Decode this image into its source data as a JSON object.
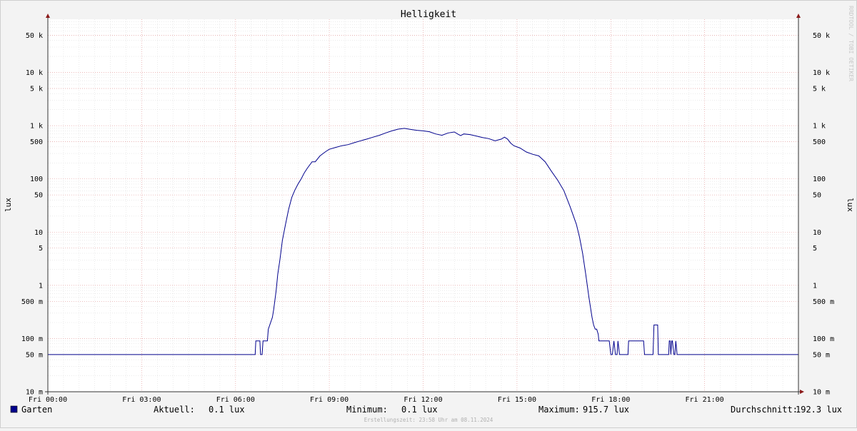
{
  "chart_data": {
    "type": "line",
    "title": "Helligkeit",
    "ylabel": "lux",
    "watermark": "RRDTOOL / TOBI OETIKER",
    "yscale": "log",
    "ylim": [
      0.01,
      100000
    ],
    "grid": true,
    "x_range_hours": [
      0,
      24
    ],
    "x_ticks": [
      {
        "hour": 0,
        "label": "Fri 00:00"
      },
      {
        "hour": 3,
        "label": "Fri 03:00"
      },
      {
        "hour": 6,
        "label": "Fri 06:00"
      },
      {
        "hour": 9,
        "label": "Fri 09:00"
      },
      {
        "hour": 12,
        "label": "Fri 12:00"
      },
      {
        "hour": 15,
        "label": "Fri 15:00"
      },
      {
        "hour": 18,
        "label": "Fri 18:00"
      },
      {
        "hour": 21,
        "label": "Fri 21:00"
      }
    ],
    "y_ticks": [
      {
        "value": 50000,
        "label": "50 k"
      },
      {
        "value": 10000,
        "label": "10 k"
      },
      {
        "value": 5000,
        "label": "5 k"
      },
      {
        "value": 1000,
        "label": "1 k"
      },
      {
        "value": 500,
        "label": "500"
      },
      {
        "value": 100,
        "label": "100"
      },
      {
        "value": 50,
        "label": "50"
      },
      {
        "value": 10,
        "label": "10"
      },
      {
        "value": 5,
        "label": "5"
      },
      {
        "value": 1,
        "label": "1"
      },
      {
        "value": 0.5,
        "label": "500 m"
      },
      {
        "value": 0.1,
        "label": "100 m"
      },
      {
        "value": 0.05,
        "label": "50 m"
      },
      {
        "value": 0.01,
        "label": "10 m"
      }
    ],
    "series": [
      {
        "name": "Garten",
        "color": "#00008c",
        "x_hours": [
          0,
          6.63,
          6.65,
          6.78,
          6.8,
          6.85,
          6.88,
          7.02,
          7.05,
          7.18,
          7.22,
          7.3,
          7.35,
          7.42,
          7.5,
          7.6,
          7.7,
          7.8,
          7.9,
          8.0,
          8.1,
          8.2,
          8.3,
          8.45,
          8.55,
          8.7,
          8.8,
          8.9,
          9.0,
          9.2,
          9.4,
          9.6,
          9.8,
          10.0,
          10.2,
          10.4,
          10.6,
          10.8,
          11.0,
          11.2,
          11.4,
          11.6,
          11.8,
          12.0,
          12.2,
          12.4,
          12.6,
          12.8,
          13.0,
          13.1,
          13.2,
          13.3,
          13.5,
          13.7,
          13.9,
          14.1,
          14.3,
          14.5,
          14.6,
          14.7,
          14.8,
          14.9,
          15.1,
          15.3,
          15.5,
          15.7,
          15.9,
          16.1,
          16.3,
          16.5,
          16.7,
          16.9,
          17.0,
          17.1,
          17.2,
          17.3,
          17.4,
          17.45,
          17.5,
          17.55,
          17.6,
          17.62,
          17.65,
          17.7,
          17.75,
          17.8,
          17.85,
          17.9,
          17.95,
          18.0,
          18.05,
          18.1,
          18.15,
          18.2,
          18.23,
          18.28,
          18.3,
          18.35,
          18.4,
          18.42,
          18.45,
          18.48,
          18.5,
          18.55,
          18.57,
          18.6,
          18.63,
          18.68,
          18.7,
          19.05,
          19.08,
          19.35,
          19.38,
          19.5,
          19.52,
          19.62,
          19.65,
          19.85,
          19.87,
          19.9,
          19.92,
          19.95,
          19.97,
          20.02,
          20.05,
          20.08,
          20.12,
          24
        ],
        "values": [
          0.05,
          0.05,
          0.09,
          0.09,
          0.05,
          0.05,
          0.09,
          0.09,
          0.15,
          0.25,
          0.35,
          0.8,
          1.6,
          3.0,
          7,
          14,
          27,
          45,
          62,
          80,
          100,
          130,
          160,
          210,
          210,
          270,
          300,
          330,
          360,
          390,
          420,
          440,
          480,
          520,
          560,
          610,
          660,
          730,
          800,
          860,
          890,
          850,
          820,
          800,
          770,
          700,
          660,
          730,
          760,
          700,
          650,
          700,
          680,
          640,
          600,
          570,
          520,
          560,
          610,
          560,
          470,
          420,
          380,
          320,
          290,
          270,
          210,
          140,
          95,
          60,
          30,
          14,
          8,
          4,
          1.6,
          0.6,
          0.25,
          0.18,
          0.15,
          0.15,
          0.12,
          0.09,
          0.09,
          0.09,
          0.09,
          0.09,
          0.09,
          0.09,
          0.09,
          0.05,
          0.05,
          0.09,
          0.05,
          0.05,
          0.09,
          0.05,
          0.05,
          0.05,
          0.05,
          0.05,
          0.05,
          0.05,
          0.05,
          0.05,
          0.09,
          0.09,
          0.09,
          0.09,
          0.09,
          0.09,
          0.05,
          0.05,
          0.18,
          0.18,
          0.05,
          0.05,
          0.05,
          0.05,
          0.09,
          0.09,
          0.05,
          0.09,
          0.09,
          0.05,
          0.05,
          0.09,
          0.05,
          0.05,
          0.05
        ]
      }
    ]
  },
  "legend": {
    "series_name": "Garten",
    "swatch_color": "#00008c",
    "current_label": "Aktuell:",
    "current_value": "0.1 lux",
    "min_label": "Minimum:",
    "min_value": "0.1 lux",
    "max_label": "Maximum:",
    "max_value": "915.7 lux",
    "avg_label": "Durchschnitt:",
    "avg_value": "192.3 lux"
  },
  "footer": "Erstellungszeit: 23:58 Uhr am 08.11.2024"
}
